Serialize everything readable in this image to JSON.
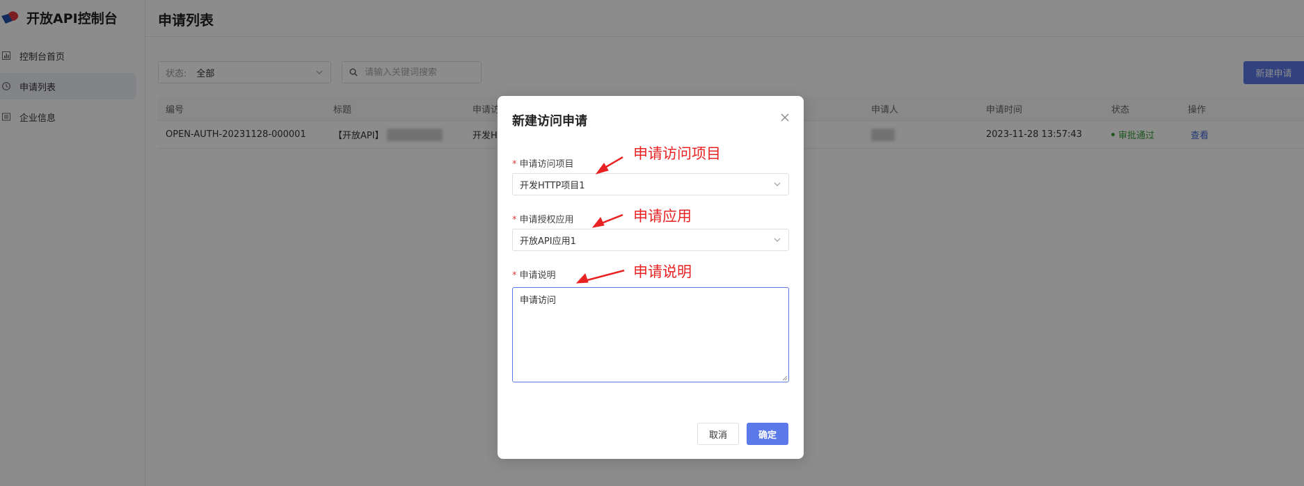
{
  "app": {
    "title": "开放API控制台",
    "brand_color": "#1f4fa8",
    "accent_red": "#e03e3e"
  },
  "sidebar": {
    "items": [
      {
        "label": "控制台首页",
        "icon": "bar-chart-icon",
        "active": false
      },
      {
        "label": "申请列表",
        "icon": "clock-icon",
        "active": true
      },
      {
        "label": "企业信息",
        "icon": "list-icon",
        "active": false
      }
    ]
  },
  "header": {
    "title": "申请列表"
  },
  "filters": {
    "status_label": "状态:",
    "status_value": "全部",
    "search_placeholder": "请输入关键词搜索",
    "new_button": "新建申请"
  },
  "table": {
    "columns": [
      "编号",
      "标题",
      "申请访",
      "申请人",
      "申请时间",
      "状态",
      "操作"
    ],
    "rows": [
      {
        "id": "OPEN-AUTH-20231128-000001",
        "title": "【开放API】",
        "project": "开发H",
        "applicant": "",
        "time": "2023-11-28 13:57:43",
        "status": "审批通过",
        "action": "查看"
      }
    ]
  },
  "modal": {
    "title": "新建访问申请",
    "field_project_label": "申请访问项目",
    "field_project_value": "开发HTTP项目1",
    "field_app_label": "申请授权应用",
    "field_app_value": "开放API应用1",
    "field_desc_label": "申请说明",
    "field_desc_value": "申请访问",
    "cancel": "取消",
    "confirm": "确定"
  },
  "annotations": {
    "project": "申请访问项目",
    "app": "申请应用",
    "desc": "申请说明"
  }
}
